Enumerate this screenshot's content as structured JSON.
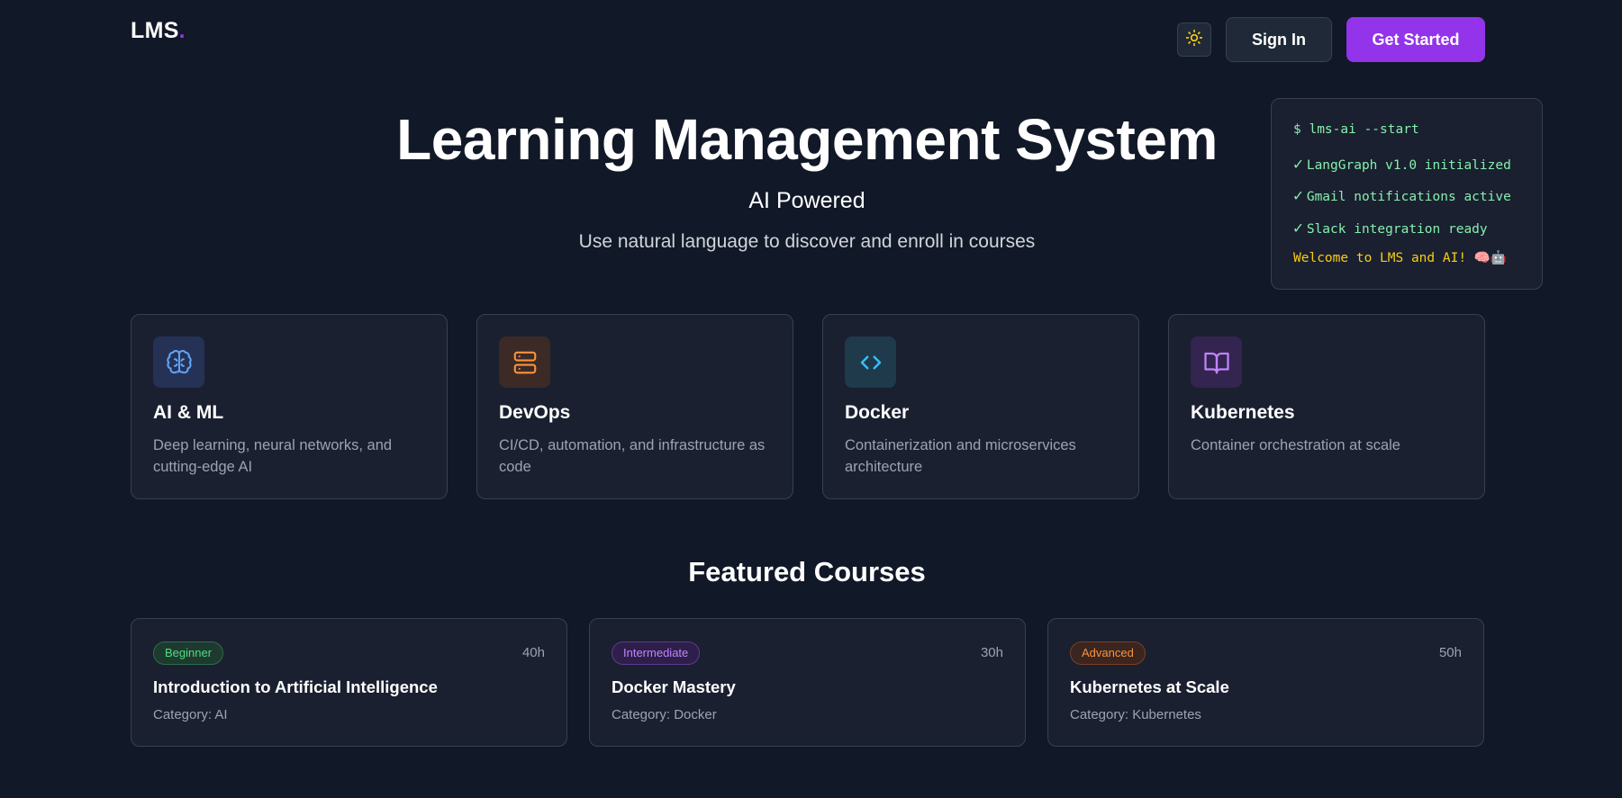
{
  "header": {
    "logo_text": "LMS",
    "logo_dot": ".",
    "theme_toggle_icon": "sun-icon",
    "sign_in_label": "Sign In",
    "get_started_label": "Get Started"
  },
  "hero": {
    "title": "Learning Management System",
    "subtitle": "AI Powered",
    "description": "Use natural language to discover and enroll in courses"
  },
  "terminal": {
    "command": "$ lms-ai --start",
    "lines": [
      {
        "check": "✓",
        "text": "LangGraph v1.0 initialized"
      },
      {
        "check": "✓",
        "text": "Gmail notifications active"
      },
      {
        "check": "✓",
        "text": "Slack integration ready"
      }
    ],
    "welcome": "Welcome to LMS and AI! 🧠🤖"
  },
  "categories": [
    {
      "icon": "brain-icon",
      "title": "AI & ML",
      "description": "Deep learning, neural networks, and cutting-edge AI",
      "icon_color": "#60a5fa",
      "icon_bg": "#253256"
    },
    {
      "icon": "server-icon",
      "title": "DevOps",
      "description": "CI/CD, automation, and infrastructure as code",
      "icon_color": "#fb923c",
      "icon_bg": "#3b2a26"
    },
    {
      "icon": "code-icon",
      "title": "Docker",
      "description": "Containerization and microservices architecture",
      "icon_color": "#38bdf8",
      "icon_bg": "#1f3a4a"
    },
    {
      "icon": "book-open-icon",
      "title": "Kubernetes",
      "description": "Container orchestration at scale",
      "icon_color": "#c084fc",
      "icon_bg": "#33254f"
    }
  ],
  "featured": {
    "title": "Featured Courses",
    "courses": [
      {
        "level": "Beginner",
        "duration": "40h",
        "title": "Introduction to Artificial Intelligence",
        "category": "Category: AI"
      },
      {
        "level": "Intermediate",
        "duration": "30h",
        "title": "Docker Mastery",
        "category": "Category: Docker"
      },
      {
        "level": "Advanced",
        "duration": "50h",
        "title": "Kubernetes at Scale",
        "category": "Category: Kubernetes"
      }
    ]
  },
  "colors": {
    "background": "#111827",
    "card": "#1a2030",
    "accent": "#9333ea",
    "terminal_green": "#86efac",
    "terminal_yellow": "#facc15"
  }
}
